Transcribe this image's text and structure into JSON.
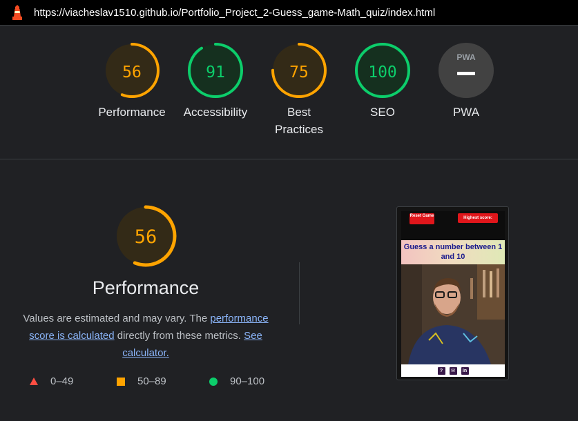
{
  "url_bar": {
    "url": "https://viacheslav1510.github.io/Portfolio_Project_2-Guess_game-Math_quiz/index.html",
    "logo_icon": "lighthouse-icon"
  },
  "gauges": [
    {
      "id": "performance",
      "score": 56,
      "label": "Performance",
      "status": "average",
      "color": "#ffa400",
      "bg": "#332a17"
    },
    {
      "id": "accessibility",
      "score": 91,
      "label": "Accessibility",
      "status": "pass",
      "color": "#0cce6b",
      "bg": "#15301f"
    },
    {
      "id": "best-practices",
      "score": 75,
      "label": "Best Practices",
      "status": "average",
      "color": "#ffa400",
      "bg": "#332a17"
    },
    {
      "id": "seo",
      "score": 100,
      "label": "SEO",
      "status": "pass",
      "color": "#0cce6b",
      "bg": "#15301f"
    },
    {
      "id": "pwa",
      "score": null,
      "label": "PWA",
      "status": "n/a",
      "badge": "PWA",
      "color": "#9aa0a6",
      "bg": "#424242"
    }
  ],
  "performance": {
    "score": 56,
    "title": "Performance",
    "desc_1": "Values are estimated and may vary. The ",
    "link_1": "performance score is calculated",
    "desc_2": " directly from these metrics. ",
    "link_2": "See calculator.",
    "color": "#ffa400"
  },
  "legend": [
    {
      "shape": "triangle",
      "range": "0–49",
      "color": "#ff4e42"
    },
    {
      "shape": "square",
      "range": "50–89",
      "color": "#ffa400"
    },
    {
      "shape": "circle",
      "range": "90–100",
      "color": "#0cce6b"
    }
  ],
  "thumbnail": {
    "reset_button": "Reset Game",
    "highest_score": "Highest score:",
    "heading": "Guess a number between 1 and 10",
    "footer_icons": [
      "question-icon",
      "envelope-icon",
      "linkedin-icon"
    ]
  }
}
